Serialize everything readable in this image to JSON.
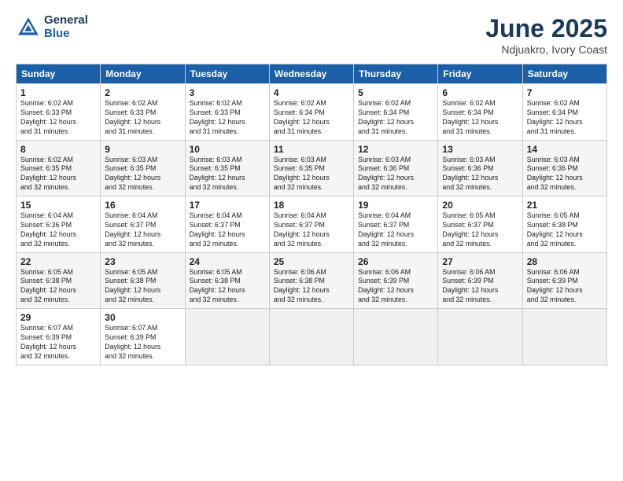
{
  "header": {
    "logo_line1": "General",
    "logo_line2": "Blue",
    "title": "June 2025",
    "subtitle": "Ndjuakro, Ivory Coast"
  },
  "weekdays": [
    "Sunday",
    "Monday",
    "Tuesday",
    "Wednesday",
    "Thursday",
    "Friday",
    "Saturday"
  ],
  "weeks": [
    [
      {
        "day": "1",
        "info": "Sunrise: 6:02 AM\nSunset: 6:33 PM\nDaylight: 12 hours\nand 31 minutes."
      },
      {
        "day": "2",
        "info": "Sunrise: 6:02 AM\nSunset: 6:33 PM\nDaylight: 12 hours\nand 31 minutes."
      },
      {
        "day": "3",
        "info": "Sunrise: 6:02 AM\nSunset: 6:33 PM\nDaylight: 12 hours\nand 31 minutes."
      },
      {
        "day": "4",
        "info": "Sunrise: 6:02 AM\nSunset: 6:34 PM\nDaylight: 12 hours\nand 31 minutes."
      },
      {
        "day": "5",
        "info": "Sunrise: 6:02 AM\nSunset: 6:34 PM\nDaylight: 12 hours\nand 31 minutes."
      },
      {
        "day": "6",
        "info": "Sunrise: 6:02 AM\nSunset: 6:34 PM\nDaylight: 12 hours\nand 31 minutes."
      },
      {
        "day": "7",
        "info": "Sunrise: 6:02 AM\nSunset: 6:34 PM\nDaylight: 12 hours\nand 31 minutes."
      }
    ],
    [
      {
        "day": "8",
        "info": "Sunrise: 6:02 AM\nSunset: 6:35 PM\nDaylight: 12 hours\nand 32 minutes."
      },
      {
        "day": "9",
        "info": "Sunrise: 6:03 AM\nSunset: 6:35 PM\nDaylight: 12 hours\nand 32 minutes."
      },
      {
        "day": "10",
        "info": "Sunrise: 6:03 AM\nSunset: 6:35 PM\nDaylight: 12 hours\nand 32 minutes."
      },
      {
        "day": "11",
        "info": "Sunrise: 6:03 AM\nSunset: 6:35 PM\nDaylight: 12 hours\nand 32 minutes."
      },
      {
        "day": "12",
        "info": "Sunrise: 6:03 AM\nSunset: 6:36 PM\nDaylight: 12 hours\nand 32 minutes."
      },
      {
        "day": "13",
        "info": "Sunrise: 6:03 AM\nSunset: 6:36 PM\nDaylight: 12 hours\nand 32 minutes."
      },
      {
        "day": "14",
        "info": "Sunrise: 6:03 AM\nSunset: 6:36 PM\nDaylight: 12 hours\nand 32 minutes."
      }
    ],
    [
      {
        "day": "15",
        "info": "Sunrise: 6:04 AM\nSunset: 6:36 PM\nDaylight: 12 hours\nand 32 minutes."
      },
      {
        "day": "16",
        "info": "Sunrise: 6:04 AM\nSunset: 6:37 PM\nDaylight: 12 hours\nand 32 minutes."
      },
      {
        "day": "17",
        "info": "Sunrise: 6:04 AM\nSunset: 6:37 PM\nDaylight: 12 hours\nand 32 minutes."
      },
      {
        "day": "18",
        "info": "Sunrise: 6:04 AM\nSunset: 6:37 PM\nDaylight: 12 hours\nand 32 minutes."
      },
      {
        "day": "19",
        "info": "Sunrise: 6:04 AM\nSunset: 6:37 PM\nDaylight: 12 hours\nand 32 minutes."
      },
      {
        "day": "20",
        "info": "Sunrise: 6:05 AM\nSunset: 6:37 PM\nDaylight: 12 hours\nand 32 minutes."
      },
      {
        "day": "21",
        "info": "Sunrise: 6:05 AM\nSunset: 6:38 PM\nDaylight: 12 hours\nand 32 minutes."
      }
    ],
    [
      {
        "day": "22",
        "info": "Sunrise: 6:05 AM\nSunset: 6:38 PM\nDaylight: 12 hours\nand 32 minutes."
      },
      {
        "day": "23",
        "info": "Sunrise: 6:05 AM\nSunset: 6:38 PM\nDaylight: 12 hours\nand 32 minutes."
      },
      {
        "day": "24",
        "info": "Sunrise: 6:05 AM\nSunset: 6:38 PM\nDaylight: 12 hours\nand 32 minutes."
      },
      {
        "day": "25",
        "info": "Sunrise: 6:06 AM\nSunset: 6:38 PM\nDaylight: 12 hours\nand 32 minutes."
      },
      {
        "day": "26",
        "info": "Sunrise: 6:06 AM\nSunset: 6:39 PM\nDaylight: 12 hours\nand 32 minutes."
      },
      {
        "day": "27",
        "info": "Sunrise: 6:06 AM\nSunset: 6:39 PM\nDaylight: 12 hours\nand 32 minutes."
      },
      {
        "day": "28",
        "info": "Sunrise: 6:06 AM\nSunset: 6:39 PM\nDaylight: 12 hours\nand 32 minutes."
      }
    ],
    [
      {
        "day": "29",
        "info": "Sunrise: 6:07 AM\nSunset: 6:39 PM\nDaylight: 12 hours\nand 32 minutes."
      },
      {
        "day": "30",
        "info": "Sunrise: 6:07 AM\nSunset: 6:39 PM\nDaylight: 12 hours\nand 32 minutes."
      },
      {
        "day": "",
        "info": ""
      },
      {
        "day": "",
        "info": ""
      },
      {
        "day": "",
        "info": ""
      },
      {
        "day": "",
        "info": ""
      },
      {
        "day": "",
        "info": ""
      }
    ]
  ]
}
